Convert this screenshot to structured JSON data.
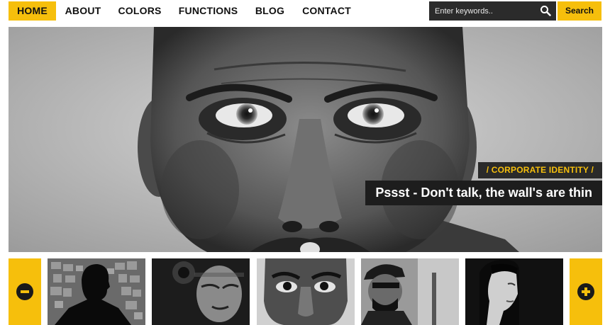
{
  "nav": {
    "items": [
      {
        "label": "HOME",
        "active": true
      },
      {
        "label": "ABOUT",
        "active": false
      },
      {
        "label": "COLORS",
        "active": false
      },
      {
        "label": "FUNCTIONS",
        "active": false
      },
      {
        "label": "BLOG",
        "active": false
      },
      {
        "label": "CONTACT",
        "active": false
      }
    ]
  },
  "search": {
    "placeholder": "Enter keywords..",
    "button_label": "Search",
    "icon": "search-icon"
  },
  "hero": {
    "category": "/ CORPORATE IDENTITY /",
    "title": "Pssst - Don't talk, the wall's are thin"
  },
  "strip": {
    "prev_icon": "minus-circle-icon",
    "next_icon": "plus-circle-icon",
    "thumbnails": [
      {
        "name": "thumb-silhouette"
      },
      {
        "name": "thumb-grimace"
      },
      {
        "name": "thumb-staring-man"
      },
      {
        "name": "thumb-cap-man"
      },
      {
        "name": "thumb-woman-profile"
      }
    ]
  },
  "colors": {
    "accent": "#f6bf0c",
    "dark": "#2b2b2b"
  }
}
